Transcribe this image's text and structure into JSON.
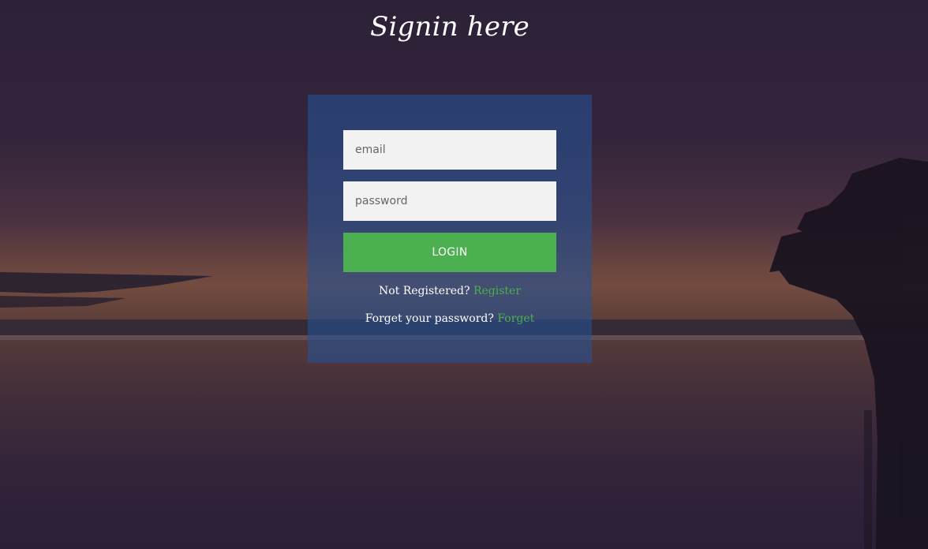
{
  "page": {
    "title": "Signin here"
  },
  "form": {
    "email_placeholder": "email",
    "password_placeholder": "password",
    "login_label": "LOGIN",
    "register_prompt": "Not Registered?",
    "register_link": "Register",
    "forget_prompt": "Forget your password?",
    "forget_link": "Forget"
  },
  "colors": {
    "panel": "#265091",
    "button": "#4caf50",
    "link": "#4caf50",
    "input_bg": "#f2f2f2"
  }
}
